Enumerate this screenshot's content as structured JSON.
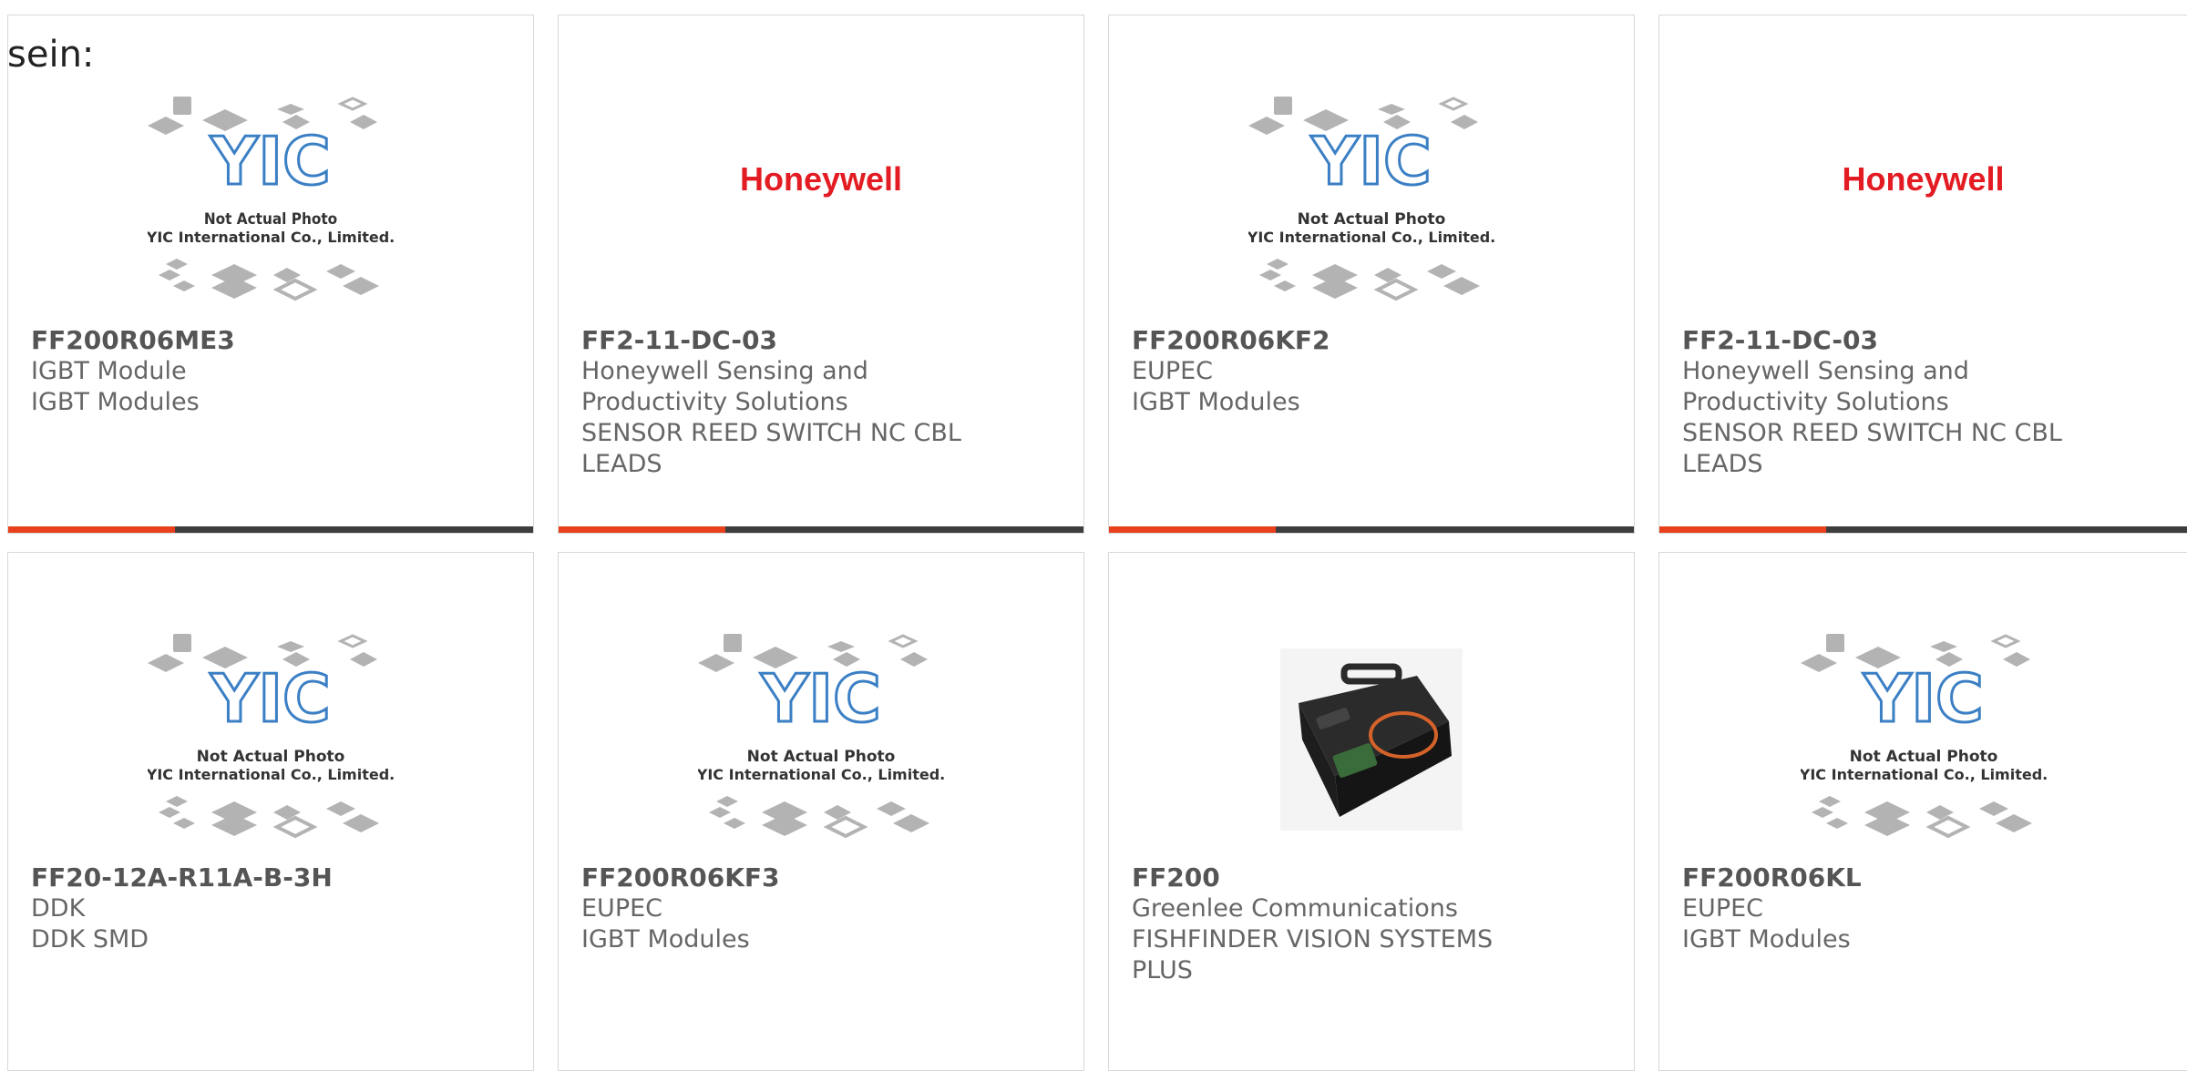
{
  "intro_text": "sein:",
  "placeholder_image": {
    "line1": "Not Actual Photo",
    "line2": "YIC International Co., Limited.",
    "logo": "YIC"
  },
  "brand_logo": {
    "text": "Honeywell",
    "color": "#e31c23"
  },
  "accent_colors": {
    "red": "#e8401c",
    "dark": "#3d3d3d"
  },
  "products": [
    {
      "part": "FF200R06ME3",
      "lines": [
        "IGBT Module",
        "IGBT Modules"
      ],
      "image": "yic-placeholder"
    },
    {
      "part": "FF2-11-DC-03",
      "lines": [
        "Honeywell Sensing and",
        "Productivity Solutions",
        "SENSOR REED SWITCH NC CBL",
        "LEADS"
      ],
      "image": "honeywell-logo"
    },
    {
      "part": "FF200R06KF2",
      "lines": [
        "EUPEC",
        "IGBT Modules"
      ],
      "image": "yic-placeholder"
    },
    {
      "part": "FF2-11-DC-03",
      "lines": [
        "Honeywell Sensing and",
        "Productivity Solutions",
        "SENSOR REED SWITCH NC CBL",
        "LEADS"
      ],
      "image": "honeywell-logo"
    },
    {
      "part": "FF20-12A-R11A-B-3H",
      "lines": [
        "DDK",
        "DDK SMD"
      ],
      "image": "yic-placeholder"
    },
    {
      "part": "FF200R06KF3",
      "lines": [
        "EUPEC",
        "IGBT Modules"
      ],
      "image": "yic-placeholder"
    },
    {
      "part": "FF200",
      "lines": [
        "Greenlee Communications",
        "FISHFINDER VISION SYSTEMS",
        "PLUS"
      ],
      "image": "tool-case-photo"
    },
    {
      "part": "FF200R06KL",
      "lines": [
        "EUPEC",
        "IGBT Modules"
      ],
      "image": "yic-placeholder"
    }
  ]
}
